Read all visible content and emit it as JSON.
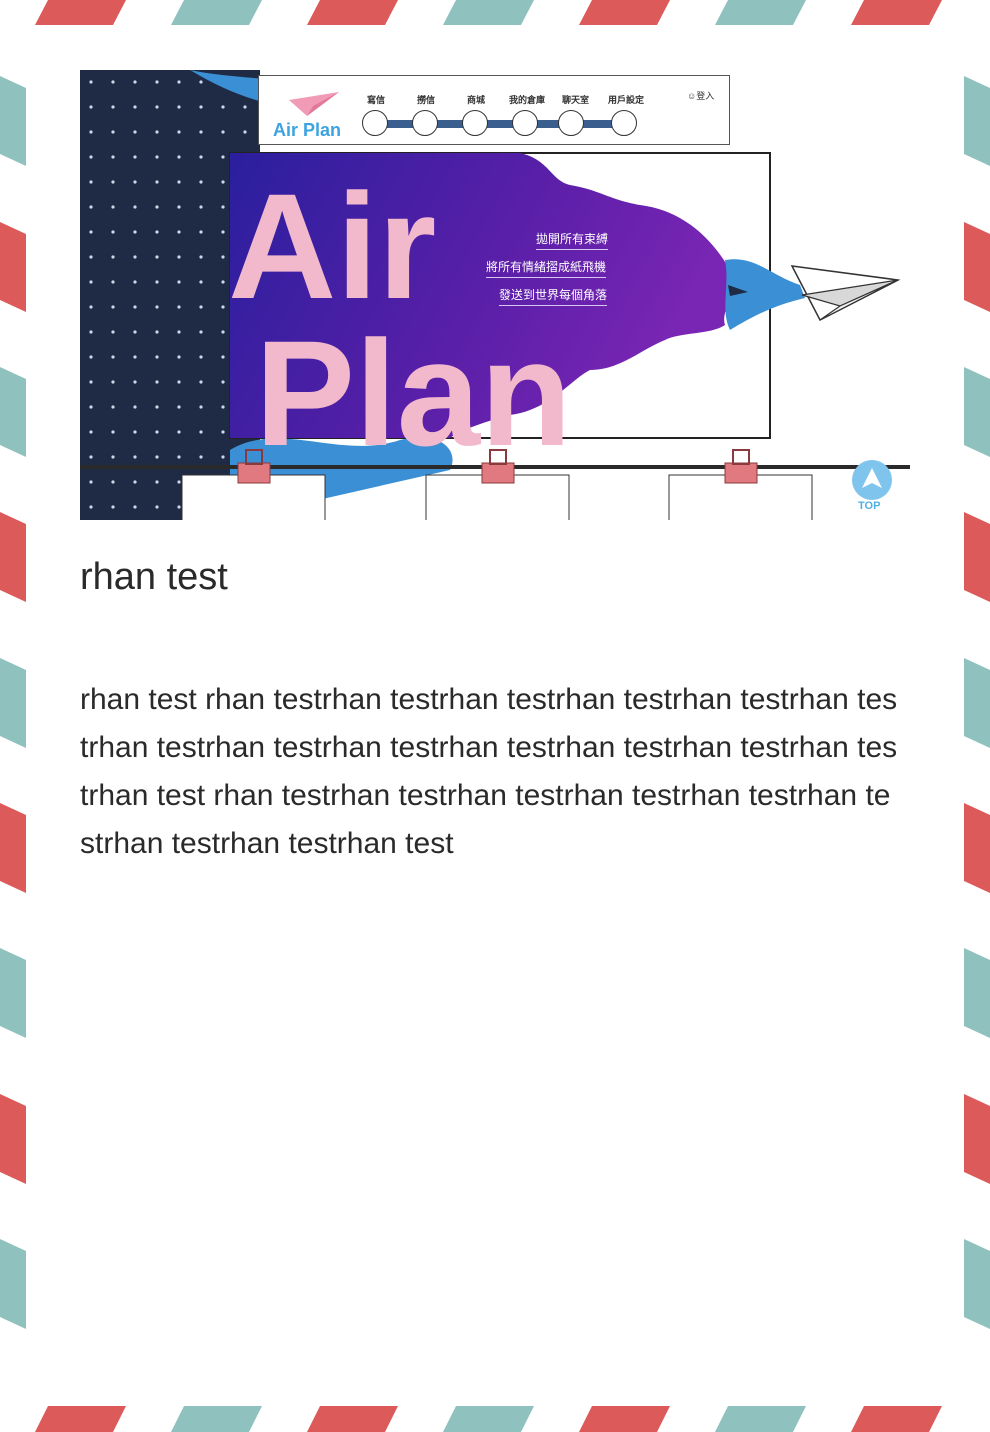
{
  "nav": {
    "logo_text": "Air Plan",
    "items": [
      {
        "label": "寫信"
      },
      {
        "label": "撈信"
      },
      {
        "label": "商城"
      },
      {
        "label": "我的倉庫"
      },
      {
        "label": "聊天室"
      },
      {
        "label": "用戶設定"
      }
    ],
    "login_label": "登入"
  },
  "hero": {
    "big_line1": "Air",
    "big_line2": "Plan",
    "taglines": [
      "拋開所有束縛",
      "將所有情緒摺成紙飛機",
      "發送到世界每個角落"
    ],
    "top_label": "TOP"
  },
  "post": {
    "title": "rhan test",
    "body": "rhan test rhan testrhan testrhan testrhan testrhan testrhan testrhan testrhan testrhan testrhan testrhan testrhan testrhan testrhan test  rhan testrhan testrhan testrhan testrhan testrhan testrhan testrhan testrhan test"
  },
  "colors": {
    "stripe_red": "#dc5a5a",
    "stripe_teal": "#8fc1bf",
    "hero_navy": "#1f2a44",
    "hero_purple": "#5a1fa8",
    "hero_pink": "#f2b8cc",
    "accent_blue": "#3da3e0"
  }
}
